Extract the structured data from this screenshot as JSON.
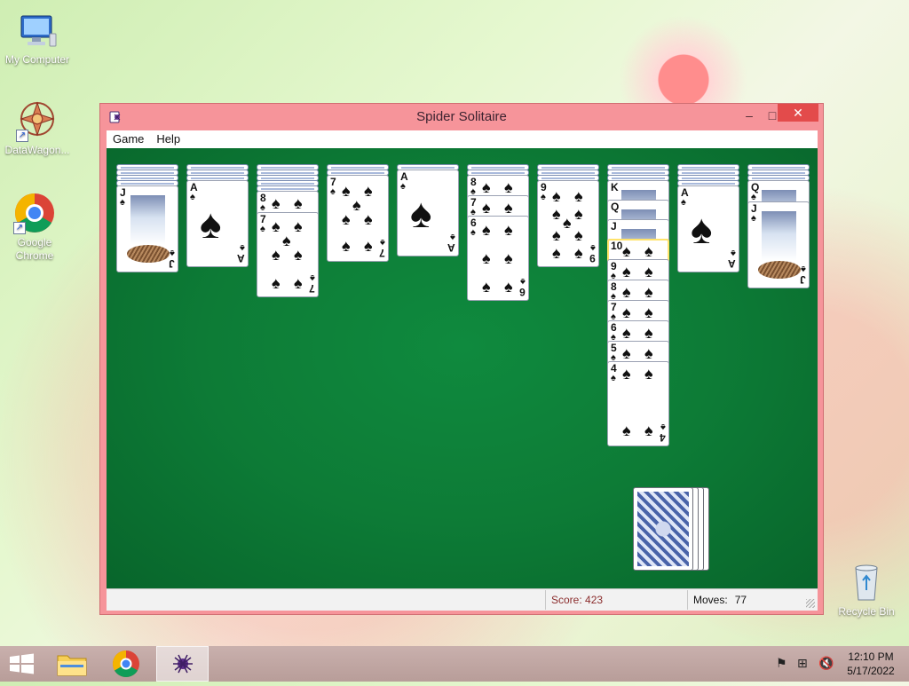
{
  "desktop": {
    "icons": [
      {
        "label": "My Computer"
      },
      {
        "label": "DataWagon..."
      },
      {
        "label": "Google Chrome"
      },
      {
        "label": "Recycle Bin"
      }
    ]
  },
  "window": {
    "title": "Spider Solitaire",
    "minimize_glyph": "–",
    "maximize_glyph": "□",
    "close_glyph": "✕"
  },
  "menu": {
    "items": [
      {
        "label": "Game"
      },
      {
        "label": "Help"
      }
    ]
  },
  "status": {
    "score": "Score: 423",
    "moves_label": "Moves:",
    "moves_value": "77"
  },
  "tableau": {
    "columns": [
      {
        "face_up": [
          "J"
        ]
      },
      {
        "face_up": [
          "A"
        ]
      },
      {
        "face_up": [
          "8",
          "7"
        ]
      },
      {
        "face_up": [
          "7"
        ]
      },
      {
        "face_up": [
          "A"
        ]
      },
      {
        "face_up": [
          "8",
          "7",
          "6"
        ]
      },
      {
        "face_up": [
          "9"
        ]
      },
      {
        "face_up": [
          "K",
          "Q",
          "J",
          "10",
          "9",
          "8",
          "7",
          "6",
          "5",
          "4"
        ]
      },
      {
        "face_up": [
          "A"
        ]
      },
      {
        "face_up": [
          "Q",
          "J"
        ]
      }
    ],
    "suit_glyph": "♠"
  },
  "taskbar": {
    "items": [
      {
        "name": "start"
      },
      {
        "name": "file-explorer"
      },
      {
        "name": "chrome"
      },
      {
        "name": "spider-solitaire"
      }
    ]
  },
  "clock": {
    "time": "12:10 PM",
    "date": "5/17/2022"
  },
  "colors": {
    "window_frame": "#f6949a",
    "table_green": "#0d7b36",
    "score_text": "#8b2d2d"
  }
}
